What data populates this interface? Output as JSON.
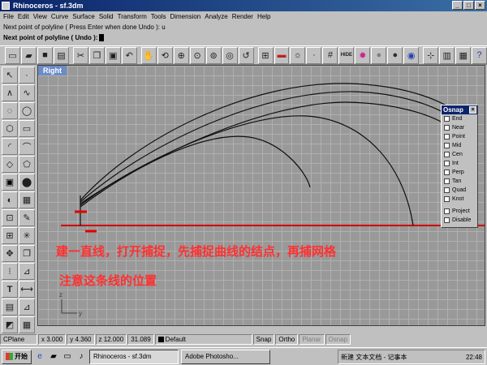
{
  "window": {
    "title": "Rhinoceros - sf.3dm",
    "buttons": [
      "_",
      "□",
      "×"
    ]
  },
  "menu": [
    "File",
    "Edit",
    "View",
    "Curve",
    "Surface",
    "Solid",
    "Transform",
    "Tools",
    "Dimension",
    "Analyze",
    "Render",
    "Help"
  ],
  "command_history": "Next point of polyline ( Press Enter when done  Undo ): u",
  "command_prompt": "Next point of polyline ( Undo ):",
  "toolbar_icons": [
    "new-icon",
    "open-icon",
    "save-icon",
    "print-icon",
    "cut-icon",
    "copy-icon",
    "paste-icon",
    "undo-icon",
    "pan-icon",
    "rotate-view-icon",
    "zoom-window-icon",
    "zoom-dynamic-icon",
    "zoom-extents-icon",
    "zoom-selected-icon",
    "undo-view-icon",
    "four-views-icon",
    "car-render-icon",
    "light-icon",
    "point-icon",
    "grid-icon",
    "hide-icon",
    "color-wheel-icon",
    "sphere-shaded-icon",
    "sphere-render-icon",
    "globe-icon",
    "point-on-icon",
    "properties-icon",
    "options-icon",
    "help-icon"
  ],
  "viewport": {
    "name": "Right"
  },
  "annotation": {
    "line1": "建一直线，打开捕捉，先捕捉曲线的结点，再捕网格",
    "line2": "注意这条线的位置"
  },
  "axis": {
    "z": "z",
    "y": "y"
  },
  "osnap": {
    "title": "Osnap",
    "close": "×",
    "items": [
      "End",
      "Near",
      "Point",
      "Mid",
      "Cen",
      "Int",
      "Perp",
      "Tan",
      "Quad",
      "Knot"
    ],
    "extra": [
      "Project",
      "Disable"
    ]
  },
  "status": {
    "cplane": "CPlane",
    "x": "x 3.000",
    "y": "y 4.360",
    "z": "z 12.000",
    "value": "31.089",
    "layer": "Default",
    "snap": "Snap",
    "ortho": "Ortho",
    "planar": "Planar",
    "osnap": "Osnap"
  },
  "taskbar": {
    "start": "开始",
    "tasks": [
      "Rhinoceros - sf.3dm",
      "Adobe Photosho..."
    ],
    "tray_text": "新建 文本文档 - 记事本",
    "clock": "22:48"
  }
}
